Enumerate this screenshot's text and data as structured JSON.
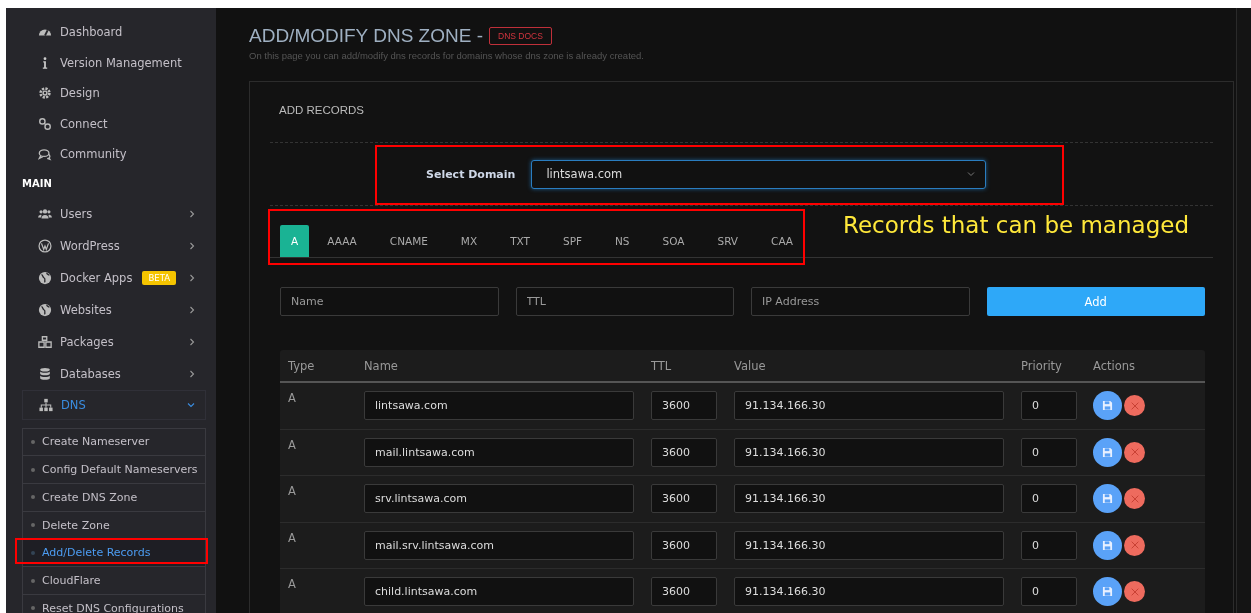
{
  "sidebar": {
    "top_items": [
      {
        "label": "Dashboard"
      },
      {
        "label": "Version Management"
      },
      {
        "label": "Design"
      },
      {
        "label": "Connect"
      },
      {
        "label": "Community"
      }
    ],
    "section_label": "MAIN",
    "items": [
      {
        "label": "Users",
        "expanded": false
      },
      {
        "label": "WordPress",
        "expanded": false
      },
      {
        "label": "Docker Apps",
        "badge": "BETA",
        "expanded": false
      },
      {
        "label": "Websites",
        "expanded": false
      },
      {
        "label": "Packages",
        "expanded": false
      },
      {
        "label": "Databases",
        "expanded": false
      },
      {
        "label": "DNS",
        "expanded": true,
        "children": [
          {
            "label": "Create Nameserver",
            "selected": false
          },
          {
            "label": "Config Default Nameservers",
            "selected": false
          },
          {
            "label": "Create DNS Zone",
            "selected": false
          },
          {
            "label": "Delete Zone",
            "selected": false
          },
          {
            "label": "Add/Delete Records",
            "selected": true
          },
          {
            "label": "CloudFlare",
            "selected": false
          },
          {
            "label": "Reset DNS Configurations",
            "selected": false
          }
        ]
      }
    ]
  },
  "page": {
    "title": "ADD/MODIFY DNS ZONE -",
    "docs_link": "DNS DOCS",
    "subtitle": "On this page you can add/modify dns records for domains whose dns zone is already created."
  },
  "panel": {
    "heading": "ADD RECORDS",
    "select_domain": {
      "label": "Select Domain",
      "value": "lintsawa.com"
    },
    "tabs": [
      {
        "label": "A",
        "selected": true
      },
      {
        "label": "AAAA",
        "selected": false
      },
      {
        "label": "CNAME",
        "selected": false
      },
      {
        "label": "MX",
        "selected": false
      },
      {
        "label": "TXT",
        "selected": false
      },
      {
        "label": "SPF",
        "selected": false
      },
      {
        "label": "NS",
        "selected": false
      },
      {
        "label": "SOA",
        "selected": false
      },
      {
        "label": "SRV",
        "selected": false
      },
      {
        "label": "CAA",
        "selected": false
      }
    ],
    "new_record": {
      "fields": [
        {
          "placeholder": "Name"
        },
        {
          "placeholder": "TTL"
        },
        {
          "placeholder": "IP Address"
        }
      ],
      "add_button": "Add"
    },
    "table": {
      "columns": [
        "Type",
        "Name",
        "TTL",
        "Value",
        "Priority",
        "Actions"
      ],
      "rows": [
        {
          "type": "A",
          "name": "lintsawa.com",
          "ttl": "3600",
          "value": "91.134.166.30",
          "priority": "0"
        },
        {
          "type": "A",
          "name": "mail.lintsawa.com",
          "ttl": "3600",
          "value": "91.134.166.30",
          "priority": "0"
        },
        {
          "type": "A",
          "name": "srv.lintsawa.com",
          "ttl": "3600",
          "value": "91.134.166.30",
          "priority": "0"
        },
        {
          "type": "A",
          "name": "mail.srv.lintsawa.com",
          "ttl": "3600",
          "value": "91.134.166.30",
          "priority": "0"
        },
        {
          "type": "A",
          "name": "child.lintsawa.com",
          "ttl": "3600",
          "value": "91.134.166.30",
          "priority": "0"
        }
      ]
    }
  },
  "annotation": {
    "note": "Records that can be managed"
  }
}
